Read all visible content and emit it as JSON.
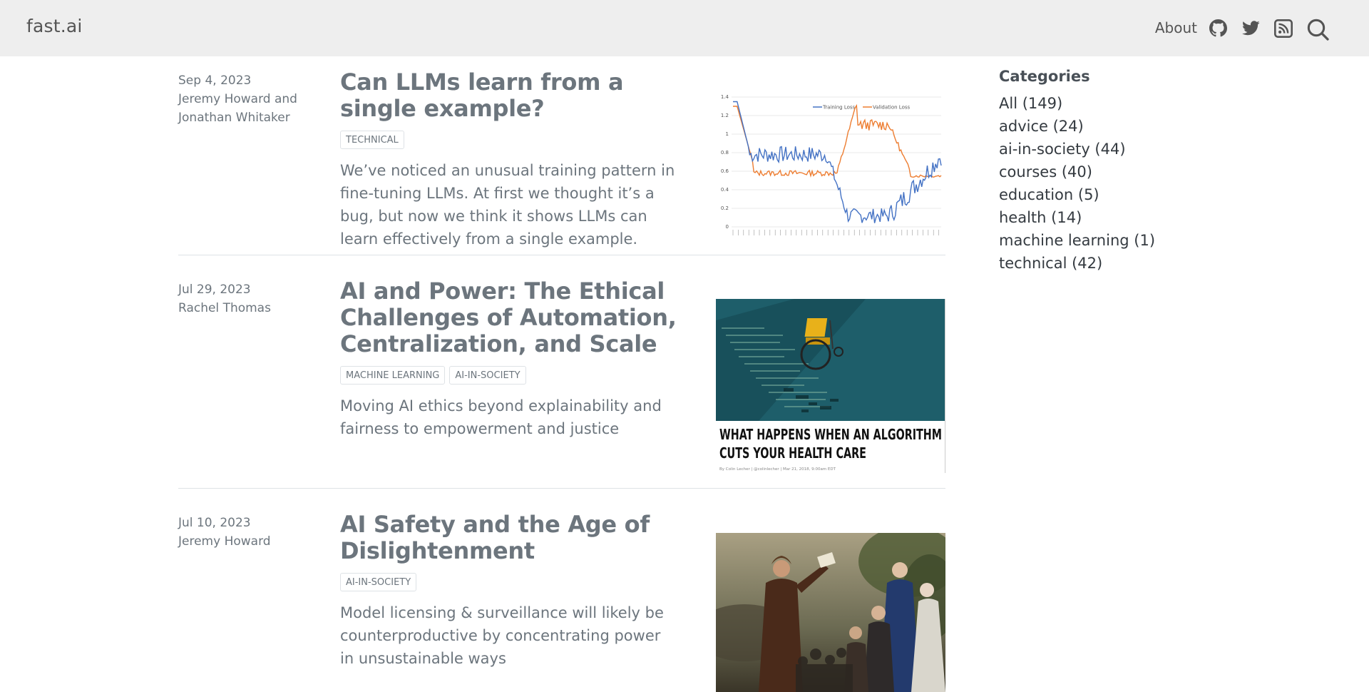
{
  "nav": {
    "brand": "fast.ai",
    "about": "About",
    "icons": [
      "github-icon",
      "twitter-icon",
      "rss-icon",
      "search-icon"
    ]
  },
  "posts": [
    {
      "date": "Sep 4, 2023",
      "author": "Jeremy Howard and Jonathan Whitaker",
      "title": "Can LLMs learn from a single example?",
      "tags": [
        "TECHNICAL"
      ],
      "description": "We’ve noticed an unusual training pattern in fine-tuning LLMs. At first we thought it’s a bug, but now we think it shows LLMs can learn effectively from a single example.",
      "thumb": {
        "legend": [
          "Training Loss",
          "Validation Loss"
        ],
        "yticks": [
          "1.4",
          "1.2",
          "1",
          "0.8",
          "0.6",
          "0.4",
          "0.2",
          "0"
        ]
      }
    },
    {
      "date": "Jul 29, 2023",
      "author": "Rachel Thomas",
      "title": "AI and Power: The Ethical Challenges of Automation, Centralization, and Scale",
      "tags": [
        "MACHINE LEARNING",
        "AI-IN-SOCIETY"
      ],
      "description": "Moving AI ethics beyond explainability and fairness to empowerment and justice",
      "thumb": {
        "headline": "WHAT HAPPENS WHEN AN ALGORITHM CUTS YOUR HEALTH CARE",
        "byline": "By Colin Lecher | @colinlecher | Mar 21, 2018, 9:00am EDT"
      }
    },
    {
      "date": "Jul 10, 2023",
      "author": "Jeremy Howard",
      "title": "AI Safety and the Age of Dislightenment",
      "tags": [
        "AI-IN-SOCIETY"
      ],
      "description": "Model licensing & surveillance will likely be counterproductive by concentrating power in unsustainable ways"
    }
  ],
  "sidebar": {
    "title": "Categories",
    "categories": [
      "All (149)",
      "advice (24)",
      "ai-in-society (44)",
      "courses (40)",
      "education (5)",
      "health (14)",
      "machine learning (1)",
      "technical (42)"
    ]
  },
  "colors": {
    "navbar_bg": "#eeeeee",
    "text_muted": "#6c757d",
    "training_loss": "#4472c4",
    "validation_loss": "#ed7d31",
    "teal_bg": "#1e5e6a"
  }
}
